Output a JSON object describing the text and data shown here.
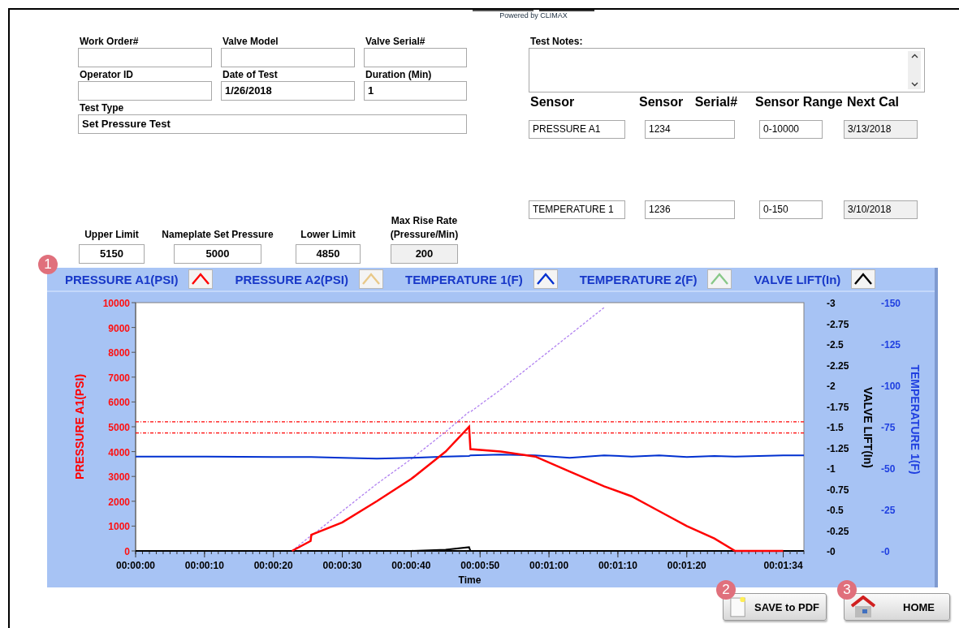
{
  "logo": {
    "tagline": "Powered by CLIMAX"
  },
  "form": {
    "fields": [
      {
        "label": "Work Order#"
      },
      {
        "label": "Valve Model"
      },
      {
        "label": "Valve Serial#"
      },
      {
        "label": "Operator ID"
      },
      {
        "label": "Date of Test",
        "value": "1/26/2018"
      },
      {
        "label": "Duration (Min)",
        "value": "1"
      }
    ],
    "test_type": {
      "label": "Test Type",
      "value": "Set Pressure Test"
    }
  },
  "limits": [
    {
      "label": "Upper Limit",
      "value": "5150",
      "readonly": false
    },
    {
      "label": "Nameplate Set Pressure",
      "value": "5000",
      "readonly": false
    },
    {
      "label": "Lower Limit",
      "value": "4850",
      "readonly": false
    },
    {
      "label": "Max Rise Rate (Pressure/Min)",
      "value": "200",
      "readonly": true
    }
  ],
  "test_notes": {
    "label": "Test Notes:"
  },
  "sensor_table": {
    "columns": [
      "Sensor",
      "Sensor Serial#",
      "Sensor Range",
      "Next Cal"
    ],
    "rows": [
      {
        "sensor": "PRESSURE A1",
        "serial": "1234",
        "range": "0-10000",
        "next_cal": "3/13/2018"
      },
      {
        "sensor": "TEMPERATURE 1",
        "serial": "1236",
        "range": "0-150",
        "next_cal": "3/10/2018"
      }
    ]
  },
  "legend": {
    "marker": "1",
    "items": [
      {
        "label": "PRESSURE A1(PSI)",
        "color": "#ff0000"
      },
      {
        "label": "PRESSURE A2(PSI)",
        "color": "#e8c888"
      },
      {
        "label": "TEMPERATURE 1(F)",
        "color": "#0030d0"
      },
      {
        "label": "TEMPERATURE 2(F)",
        "color": "#88c888"
      },
      {
        "label": "VALVE LIFT(In)",
        "color": "#000000"
      }
    ]
  },
  "chart": {
    "chart_data": {
      "type": "line",
      "xlabel": "Time",
      "ylabel": "PRESSURE A1(PSI)",
      "x": [
        0,
        10,
        20,
        22.7,
        25.4,
        25.5,
        30,
        35,
        40,
        45,
        48.4,
        48.6,
        53,
        58,
        63,
        68,
        72,
        76,
        80,
        84,
        87,
        94,
        97
      ],
      "series": [
        {
          "color": "#ff0000",
          "line_style": "solid",
          "values": [
            null,
            null,
            null,
            0,
            400,
            650,
            1150,
            2000,
            2900,
            4000,
            5000,
            4100,
            4000,
            3800,
            3200,
            2600,
            2200,
            1600,
            1000,
            500,
            0,
            0,
            null
          ]
        },
        {
          "color": "#0030d0",
          "line_style": "solid",
          "values": [
            3800,
            3800,
            3780,
            3780,
            3780,
            3780,
            3750,
            3720,
            3750,
            3800,
            3820,
            3850,
            3880,
            3850,
            3750,
            3850,
            3800,
            3850,
            3780,
            3820,
            3800,
            3850,
            3850
          ]
        },
        {
          "color": "#000000",
          "line_style": "solid",
          "values": [
            0,
            0,
            0,
            0,
            0,
            0,
            0,
            0,
            0,
            50,
            150,
            0,
            0,
            0,
            0,
            0,
            0,
            0,
            0,
            0,
            0,
            0,
            null
          ]
        },
        {
          "color": "#ff0000",
          "line_style": "dashdot",
          "values": [
            5200,
            5200,
            5200,
            5200,
            5200,
            5200,
            5200,
            5200,
            5200,
            5200,
            5200,
            5200,
            5200,
            5200,
            5200,
            5200,
            5200,
            5200,
            5200,
            5200,
            5200,
            5200,
            5200
          ]
        },
        {
          "color": "#ff0000",
          "line_style": "dashdot",
          "values": [
            4750,
            4750,
            4750,
            4750,
            4750,
            4750,
            4750,
            4750,
            4750,
            4750,
            4750,
            4750,
            4750,
            4750,
            4750,
            4750,
            4750,
            4750,
            4750,
            4750,
            4750,
            4750,
            4750
          ]
        },
        {
          "color": "#b080f0",
          "line_style": "dashed",
          "values": [
            null,
            null,
            null,
            0,
            600,
            600,
            1600,
            2700,
            3700,
            4800,
            5600,
            5600,
            6500,
            7600,
            8700,
            9800,
            null,
            null,
            null,
            null,
            null,
            null,
            null
          ]
        }
      ],
      "xlim": [
        0,
        97
      ],
      "ylim": [
        0,
        10000
      ],
      "xticks": [
        {
          "value": 0,
          "label": "00:00:00"
        },
        {
          "value": 10,
          "label": "00:00:10"
        },
        {
          "value": 20,
          "label": "00:00:20"
        },
        {
          "value": 30,
          "label": "00:00:30"
        },
        {
          "value": 40,
          "label": "00:00:40"
        },
        {
          "value": 50,
          "label": "00:00:50"
        },
        {
          "value": 60,
          "label": "00:01:00"
        },
        {
          "value": 70,
          "label": "00:01:10"
        },
        {
          "value": 80,
          "label": "00:01:20"
        },
        {
          "value": 94,
          "label": "00:01:34"
        }
      ],
      "yticks": [
        0,
        1000,
        2000,
        3000,
        4000,
        5000,
        6000,
        7000,
        8000,
        9000,
        10000
      ],
      "stacked": false
    },
    "right_axes": [
      {
        "title": "VALVE LIFT(In)",
        "color": "#000000",
        "ticks": [
          "-3",
          "-2.75",
          "-2.5",
          "-2.25",
          "-2",
          "-1.75",
          "-1.5",
          "-1.25",
          "-1",
          "-0.75",
          "-0.5",
          "-0.25",
          "-0"
        ]
      },
      {
        "title": "TEMPERATURE 1(F)",
        "color": "#2040e0",
        "ticks": [
          "-150",
          "-125",
          "-100",
          "-75",
          "-50",
          "-25",
          "-0"
        ]
      }
    ]
  },
  "buttons": [
    {
      "label": "SAVE to PDF",
      "kind": "save",
      "marker": "2"
    },
    {
      "label": "HOME",
      "kind": "home",
      "marker": "3"
    }
  ]
}
